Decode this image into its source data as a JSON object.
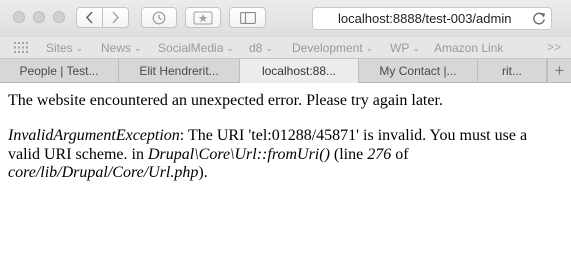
{
  "toolbar": {
    "address": "localhost:8888/test-003/admin",
    "icons": {
      "close": "window-close-icon",
      "minimize": "window-minimize-icon",
      "maximize": "window-maximize-icon",
      "back": "back-icon",
      "forward": "forward-icon",
      "history": "clock-icon",
      "bookmark": "star-icon",
      "sidebar": "sidebar-icon",
      "reload": "reload-icon"
    }
  },
  "favorites": {
    "items": [
      {
        "label": "Sites",
        "has_menu": true
      },
      {
        "label": "News",
        "has_menu": true
      },
      {
        "label": "SocialMedia",
        "has_menu": true
      },
      {
        "label": "d8",
        "has_menu": true
      },
      {
        "label": "Development",
        "has_menu": true
      },
      {
        "label": "WP",
        "has_menu": true
      },
      {
        "label": "Amazon Link",
        "has_menu": false
      }
    ],
    "overflow": ">>"
  },
  "tabs": [
    {
      "label": "People | Test...",
      "active": false
    },
    {
      "label": "Elit Hendrerit...",
      "active": false
    },
    {
      "label": "localhost:88...",
      "active": true
    },
    {
      "label": "My Contact |...",
      "active": false
    },
    {
      "label": "rit...",
      "active": false
    }
  ],
  "new_tab": "+",
  "page": {
    "message": "The website encountered an unexpected error. Please try again later.",
    "error": {
      "exception": "InvalidArgumentException",
      "text_1": ": The URI 'tel:01288/45871' is invalid. You must use a valid URI scheme. in ",
      "method": "Drupal\\Core\\Url::fromUri()",
      "text_2": " (line ",
      "line": "276",
      "text_3": " of ",
      "file": "core/lib/Drupal/Core/Url.php",
      "text_4": ")."
    }
  },
  "colors": {
    "toolbar_bg": "#e4e4e4",
    "favbar_text": "#9a9a9a",
    "tab_active_bg": "#ececec",
    "tab_bar_bg": "#d7d7d7"
  }
}
